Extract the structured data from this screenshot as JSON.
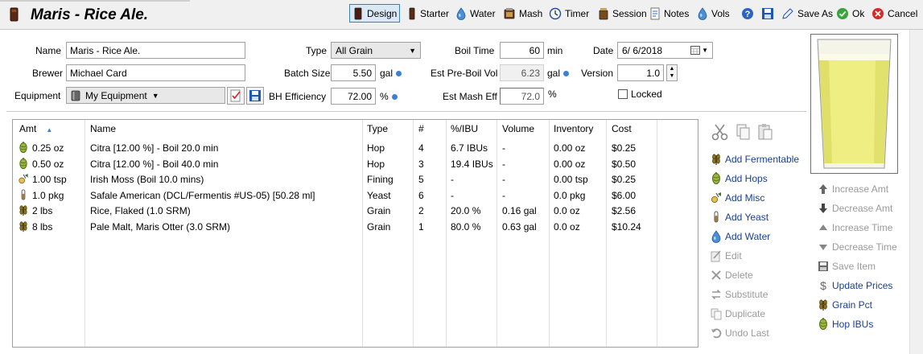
{
  "title": "Maris - Rice Ale.",
  "toolbar": {
    "design": "Design",
    "starter": "Starter",
    "water": "Water",
    "mash": "Mash",
    "timer": "Timer",
    "session": "Session",
    "notes": "Notes",
    "vols": "Vols",
    "save_as": "Save As",
    "ok": "Ok",
    "cancel": "Cancel"
  },
  "form": {
    "name_label": "Name",
    "name_value": "Maris - Rice Ale.",
    "brewer_label": "Brewer",
    "brewer_value": "Michael Card",
    "equipment_label": "Equipment",
    "equipment_value": "My Equipment",
    "type_label": "Type",
    "type_value": "All Grain",
    "batch_label": "Batch Size",
    "batch_value": "5.50",
    "batch_unit": "gal",
    "bh_label": "BH Efficiency",
    "bh_value": "72.00",
    "bh_unit": "%",
    "boil_label": "Boil Time",
    "boil_value": "60",
    "boil_unit": "min",
    "preboil_label": "Est Pre-Boil Vol",
    "preboil_value": "6.23",
    "preboil_unit": "gal",
    "mash_label": "Est Mash Eff",
    "mash_value": "72.0",
    "mash_unit": "%",
    "date_label": "Date",
    "date_value": "6/  6/2018",
    "version_label": "Version",
    "version_value": "1.0",
    "locked_label": "Locked"
  },
  "table": {
    "headers": [
      "Amt",
      "Name",
      "Type",
      "#",
      "%/IBU",
      "Volume",
      "Inventory",
      "Cost"
    ],
    "rows": [
      {
        "icon": "hop-icon",
        "amt": "0.25 oz",
        "name": "Citra [12.00 %] - Boil 20.0 min",
        "type": "Hop",
        "num": "4",
        "pct": "6.7 IBUs",
        "volume": "-",
        "inventory": "0.00 oz",
        "cost": "$0.25"
      },
      {
        "icon": "hop-icon",
        "amt": "0.50 oz",
        "name": "Citra [12.00 %] - Boil 40.0 min",
        "type": "Hop",
        "num": "3",
        "pct": "19.4 IBUs",
        "volume": "-",
        "inventory": "0.00 oz",
        "cost": "$0.50"
      },
      {
        "icon": "misc-icon",
        "amt": "1.00 tsp",
        "name": "Irish Moss (Boil 10.0 mins)",
        "type": "Fining",
        "num": "5",
        "pct": "-",
        "volume": "-",
        "inventory": "0.00 tsp",
        "cost": "$0.25"
      },
      {
        "icon": "yeast-icon",
        "amt": "1.0 pkg",
        "name": "Safale American  (DCL/Fermentis #US-05) [50.28 ml]",
        "type": "Yeast",
        "num": "6",
        "pct": "-",
        "volume": "-",
        "inventory": "0.0 pkg",
        "cost": "$6.00"
      },
      {
        "icon": "grain-icon",
        "amt": "2 lbs",
        "name": "Rice, Flaked (1.0 SRM)",
        "type": "Grain",
        "num": "2",
        "pct": "20.0 %",
        "volume": "0.16 gal",
        "inventory": "0.0 oz",
        "cost": "$2.56"
      },
      {
        "icon": "grain-icon",
        "amt": "8 lbs",
        "name": "Pale Malt, Maris Otter (3.0 SRM)",
        "type": "Grain",
        "num": "1",
        "pct": "80.0 %",
        "volume": "0.63 gal",
        "inventory": "0.0 oz",
        "cost": "$10.24"
      }
    ]
  },
  "actions": {
    "add_fermentable": "Add Fermentable",
    "add_hops": "Add Hops",
    "add_misc": "Add Misc",
    "add_yeast": "Add Yeast",
    "add_water": "Add Water",
    "edit": "Edit",
    "delete": "Delete",
    "substitute": "Substitute",
    "duplicate": "Duplicate",
    "undo_last": "Undo Last"
  },
  "side": {
    "increase_amt": "Increase Amt",
    "decrease_amt": "Decrease Amt",
    "increase_time": "Increase Time",
    "decrease_time": "Decrease Time",
    "save_item": "Save Item",
    "update_prices": "Update Prices",
    "grain_pct": "Grain Pct",
    "hop_ibus": "Hop IBUs"
  },
  "colors": {
    "accent": "#1a3f8f",
    "beer": "#eeee82",
    "hop": "#8ba83a",
    "grain": "#6b5a1e"
  }
}
